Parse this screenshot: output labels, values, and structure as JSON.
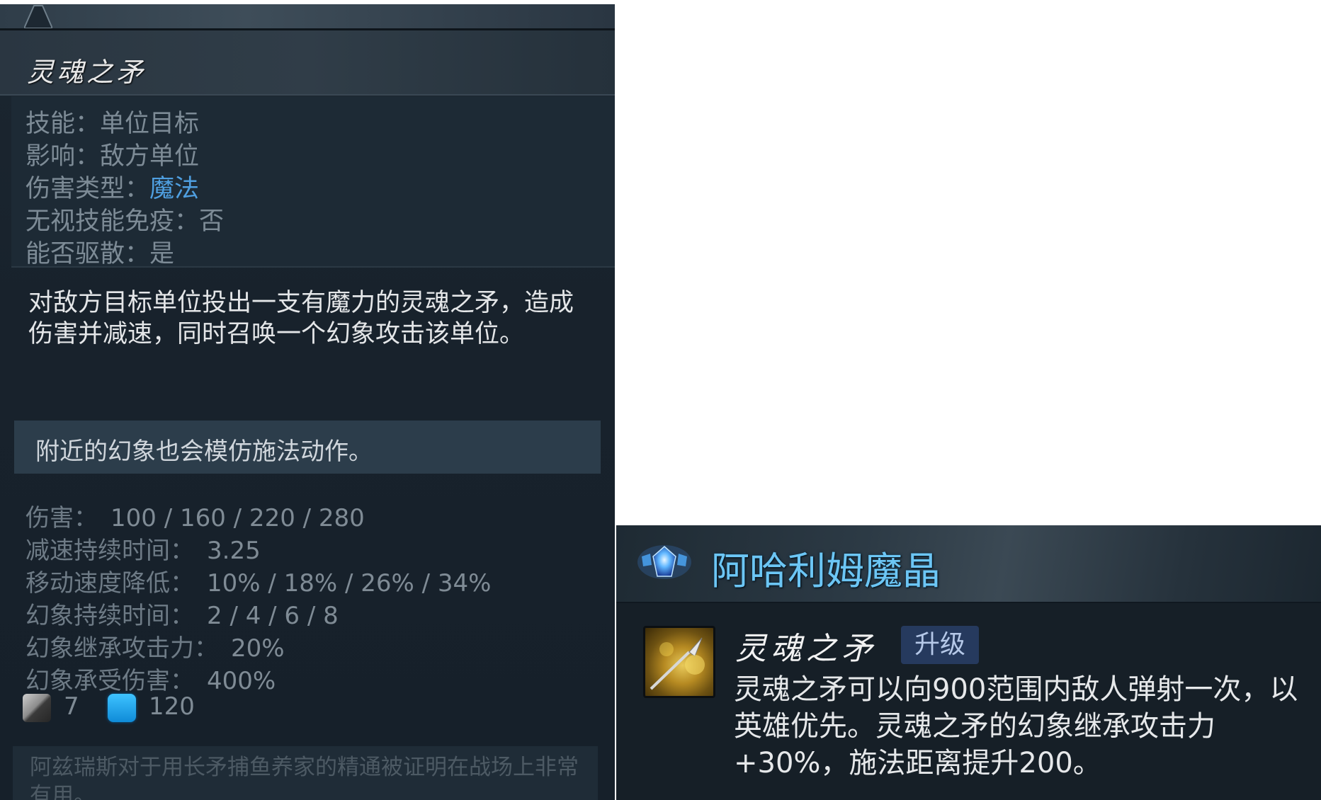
{
  "tooltip": {
    "ability_name": "灵魂之矛",
    "info": {
      "ability_label": "技能：",
      "ability_value": "单位目标",
      "affects_label": "影响：",
      "affects_value": "敌方单位",
      "damage_type_label": "伤害类型：",
      "damage_type_value": "魔法",
      "pierce_immunity_label": "无视技能免疫：",
      "pierce_immunity_value": "否",
      "dispellable_label": "能否驱散：",
      "dispellable_value": "是"
    },
    "description": "对敌方目标单位投出一支有魔力的灵魂之矛，造成伤害并减速，同时召唤一个幻象攻击该单位。",
    "note": "附近的幻象也会模仿施法动作。",
    "stats": [
      {
        "label": "伤害：",
        "value": "100 / 160 / 220 / 280"
      },
      {
        "label": "减速持续时间：",
        "value": "3.25"
      },
      {
        "label": "移动速度降低：",
        "value": "10% / 18% / 26% / 34%"
      },
      {
        "label": "幻象持续时间：",
        "value": "2 / 4 / 6 / 8"
      },
      {
        "label": "幻象继承攻击力：",
        "value": "20%"
      },
      {
        "label": "幻象承受伤害：",
        "value": "400%"
      }
    ],
    "cooldown": "7",
    "mana_cost": "120",
    "lore": "阿兹瑞斯对于用长矛捕鱼养家的精通被证明在战场上非常有用。"
  },
  "aghs": {
    "title": "阿哈利姆魔晶",
    "skill_name": "灵魂之矛",
    "badge": "升级",
    "description": "灵魂之矛可以向900范围内敌人弹射一次，以英雄优先。灵魂之矛的幻象继承攻击力+30%，施法距离提升200。"
  },
  "colors": {
    "magic_damage": "#4f9fe0",
    "aghs_title": "#6cc6f5",
    "mana": "#1fa5ee"
  },
  "icons": [
    "cooldown-icon",
    "mana-icon",
    "aghanim-shard-gem-icon",
    "spirit-lance-icon"
  ]
}
